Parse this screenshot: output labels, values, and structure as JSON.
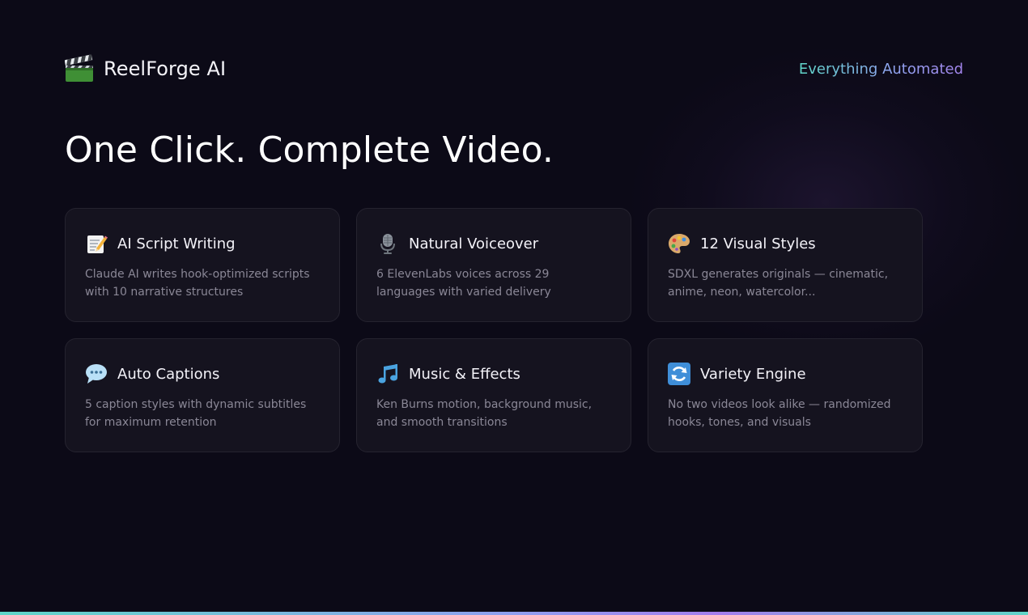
{
  "header": {
    "brand_name": "ReelForge AI",
    "brand_icon": "clapperboard-icon",
    "tagline": "Everything Automated"
  },
  "hero": {
    "headline": "One Click. Complete Video."
  },
  "features": [
    {
      "icon": "memo-icon",
      "title": "AI Script Writing",
      "description": "Claude AI writes hook-optimized scripts with 10 narrative structures"
    },
    {
      "icon": "microphone-icon",
      "title": "Natural Voiceover",
      "description": "6 ElevenLabs voices across 29 languages with varied delivery"
    },
    {
      "icon": "palette-icon",
      "title": "12 Visual Styles",
      "description": "SDXL generates originals — cinematic, anime, neon, watercolor..."
    },
    {
      "icon": "speech-bubble-icon",
      "title": "Auto Captions",
      "description": "5 caption styles with dynamic subtitles for maximum retention"
    },
    {
      "icon": "music-notes-icon",
      "title": "Music & Effects",
      "description": "Ken Burns motion, background music, and smooth transitions"
    },
    {
      "icon": "refresh-icon",
      "title": "Variety Engine",
      "description": "No two videos look alike — randomized hooks, tones, and visuals"
    }
  ],
  "colors": {
    "background": "#0c0a17",
    "card_background": "#15131f",
    "card_border": "#25232f",
    "accent_teal": "#5fd6c8",
    "accent_purple": "#a585ee",
    "muted_text": "#8a8796"
  }
}
